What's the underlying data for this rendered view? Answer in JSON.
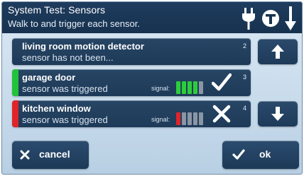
{
  "header": {
    "title": "System Test: Sensors",
    "subtitle": "Walk to and trigger each sensor.",
    "icons": [
      "power-plug-icon",
      "t-circle-icon",
      "down-arrow-icon"
    ]
  },
  "sensors": [
    {
      "name": "living room motion detector",
      "status": "sensor has not been...",
      "number": "2",
      "strip_color": null,
      "signal_label": "",
      "signal_level": null,
      "result": null
    },
    {
      "name": "garage door",
      "status": "sensor was triggered",
      "number": "3",
      "strip_color": "#22c23a",
      "signal_label": "signal:",
      "signal_level": 4,
      "signal_total": 5,
      "signal_color": "#2ccd3a",
      "result": "check"
    },
    {
      "name": "kitchen window",
      "status": "sensor was triggered",
      "number": "4",
      "strip_color": "#e0242a",
      "signal_label": "signal:",
      "signal_level": 1,
      "signal_total": 5,
      "signal_color": "#e0242a",
      "result": "cross"
    }
  ],
  "scroll": {
    "up_icon": "up-arrow-icon",
    "down_icon": "down-arrow-icon"
  },
  "footer": {
    "cancel_label": "cancel",
    "ok_label": "ok"
  },
  "colors": {
    "header_bg": "#1b3656",
    "item_bg": "#213f5f",
    "panel_bg": "#c9dcec",
    "inactive_bar": "#8a96a3"
  }
}
